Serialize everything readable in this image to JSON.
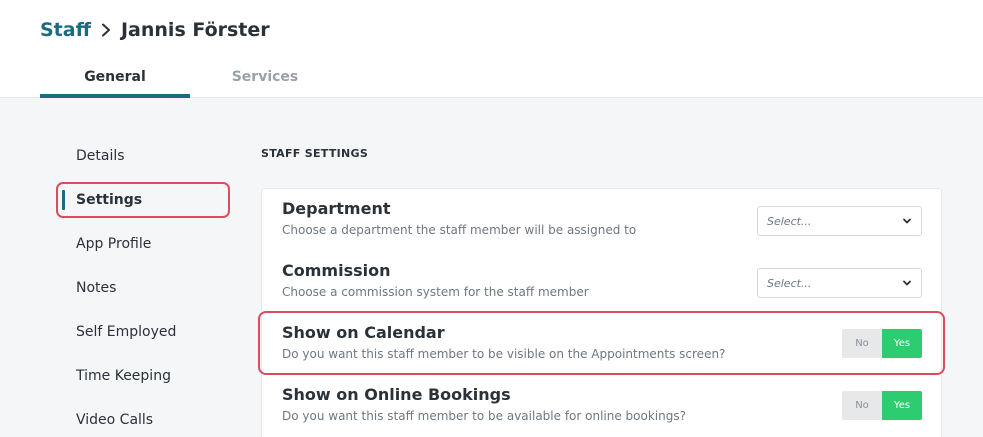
{
  "breadcrumb": {
    "parent": "Staff",
    "current": "Jannis Förster"
  },
  "tabs": [
    {
      "label": "General",
      "active": true
    },
    {
      "label": "Services",
      "active": false
    }
  ],
  "sidebar": {
    "items": [
      {
        "label": "Details"
      },
      {
        "label": "Settings",
        "active": true
      },
      {
        "label": "App Profile"
      },
      {
        "label": "Notes"
      },
      {
        "label": "Self Employed"
      },
      {
        "label": "Time Keeping"
      },
      {
        "label": "Video Calls"
      }
    ]
  },
  "section": {
    "title": "STAFF SETTINGS"
  },
  "settings": {
    "department": {
      "title": "Department",
      "desc": "Choose a department the staff member will be assigned to",
      "value": "Select..."
    },
    "commission": {
      "title": "Commission",
      "desc": "Choose a commission system for the staff member",
      "value": "Select..."
    },
    "show_calendar": {
      "title": "Show on Calendar",
      "desc": "Do you want this staff member to be visible on the Appointments screen?",
      "no": "No",
      "yes": "Yes",
      "selected": "Yes"
    },
    "show_online": {
      "title": "Show on Online Bookings",
      "desc": "Do you want this staff member to be available for online bookings?",
      "no": "No",
      "yes": "Yes",
      "selected": "Yes"
    }
  },
  "colors": {
    "brand": "#1b6b83",
    "highlight": "#e04a5f",
    "yes": "#2ecc71"
  }
}
